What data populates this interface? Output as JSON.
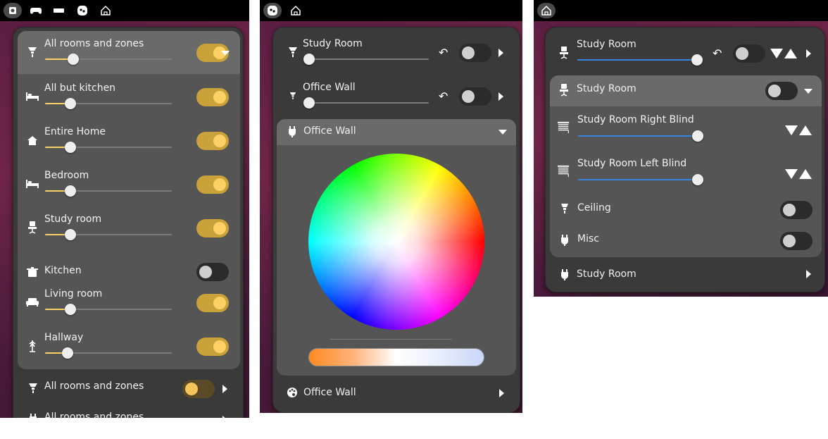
{
  "colors": {
    "accent_yellow": "#ffd066",
    "toggle_on_track": "#c9a33a",
    "slider_blue": "#3584e4",
    "panel_bg": "#3a3a3a",
    "card_bg": "#555555"
  },
  "screen1": {
    "topbar_icons": [
      "camera-icon",
      "gamepad-icon",
      "battery-icon",
      "home-assistant-icon",
      "home-icon"
    ],
    "rows": [
      {
        "label": "All rooms and zones",
        "icon": "ceiling-light-icon",
        "level": 0.22,
        "on": true
      },
      {
        "label": "All but kitchen",
        "icon": "bed-icon",
        "level": 0.2,
        "on": true
      },
      {
        "label": "Entire Home",
        "icon": "home-icon",
        "level": 0.2,
        "on": true
      },
      {
        "label": "Bedroom",
        "icon": "bed-icon",
        "level": 0.2,
        "on": true
      },
      {
        "label": "Study room",
        "icon": "chair-icon",
        "level": 0.2,
        "on": true
      },
      {
        "label": "Kitchen",
        "icon": "pot-icon",
        "on": false
      },
      {
        "label": "Living room",
        "icon": "sofa-icon",
        "level": 0.2,
        "on": true
      },
      {
        "label": "Hallway",
        "icon": "coat-rack-icon",
        "level": 0.18,
        "on": true
      }
    ],
    "footer": [
      {
        "label": "All rooms and zones",
        "icon": "ceiling-light-icon"
      },
      {
        "label": "All rooms and zones",
        "icon": "plug-icon"
      }
    ]
  },
  "screen2": {
    "topbar_icons": [
      "home-assistant-icon",
      "home-icon"
    ],
    "rows": [
      {
        "label": "Study Room",
        "icon": "ceiling-light-icon",
        "level": 0.0,
        "on": false
      },
      {
        "label": "Office Wall",
        "icon": "ceiling-light-icon",
        "level": 0.0,
        "on": false
      }
    ],
    "expanded_title": "Office Wall",
    "footer_label": "Office Wall"
  },
  "screen3": {
    "topbar_icons": [
      "home-icon"
    ],
    "top_row": {
      "label": "Study Room",
      "level": 1.0,
      "on": false
    },
    "group_title": "Study Room",
    "blinds": [
      {
        "label": "Study Room Right Blind",
        "level": 1.0
      },
      {
        "label": "Study Room Left Blind",
        "level": 1.0
      }
    ],
    "switches": [
      {
        "label": "Ceiling",
        "icon": "ceiling-light-icon",
        "on": false
      },
      {
        "label": "Misc",
        "icon": "plug-icon",
        "on": false
      }
    ],
    "footer_label": "Study Room"
  }
}
